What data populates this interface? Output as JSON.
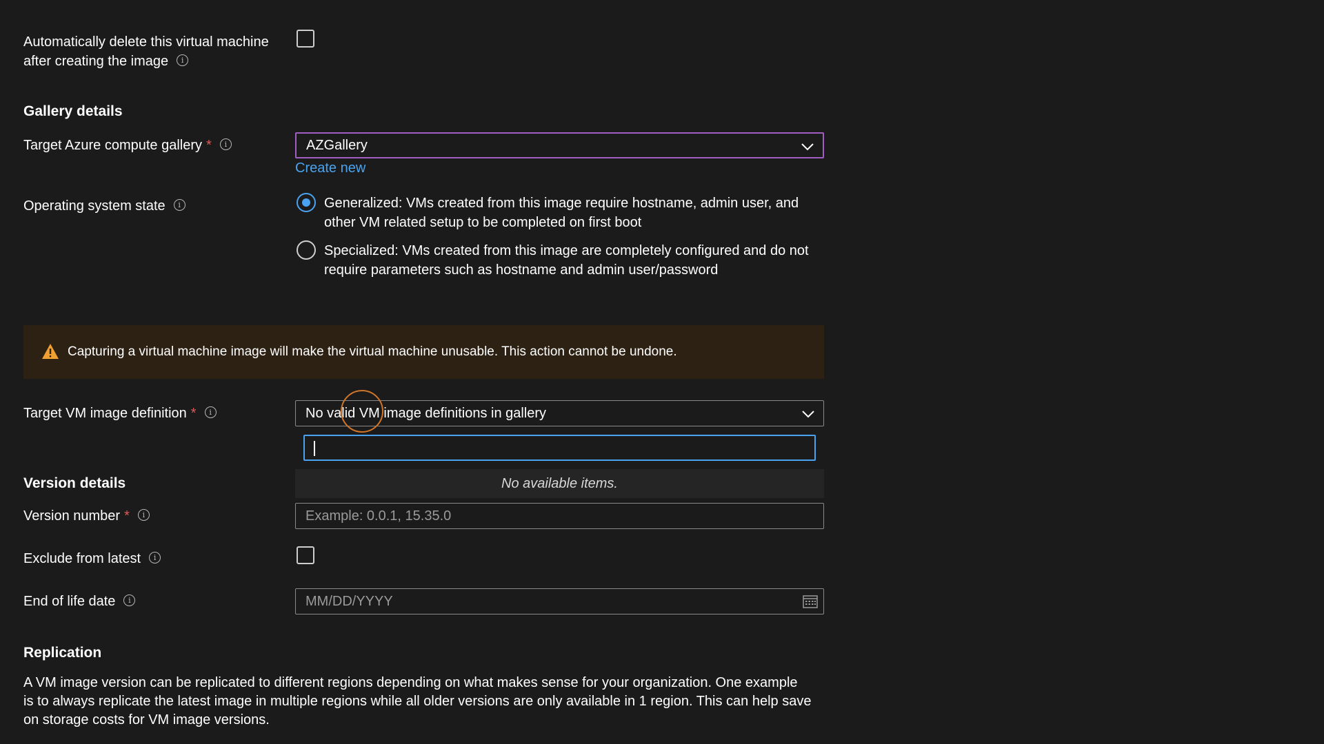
{
  "auto_delete": {
    "label_line1": "Automatically delete this virtual machine",
    "label_line2": "after creating the image",
    "checked": false
  },
  "gallery_details": {
    "heading": "Gallery details",
    "target_gallery_label": "Target Azure compute gallery",
    "target_gallery_value": "AZGallery",
    "create_new_link": "Create new",
    "os_state_label": "Operating system state",
    "os_state_options": [
      {
        "line1": "Generalized: VMs created from this image require hostname, admin user, and",
        "line2": "other VM related setup to be completed on first boot",
        "selected": true
      },
      {
        "line1": "Specialized: VMs created from this image are completely configured and do not",
        "line2": "require parameters such as hostname and admin user/password",
        "selected": false
      }
    ]
  },
  "warning": {
    "text": "Capturing a virtual machine image will make the virtual machine unusable. This action cannot be undone.",
    "icon": "warning-icon"
  },
  "image_definition": {
    "label": "Target VM image definition",
    "value": "No valid VM image definitions in gallery",
    "search_value": "",
    "empty_text": "No available items."
  },
  "version_details": {
    "heading": "Version details",
    "version_number_label": "Version number",
    "version_number_placeholder": "Example: 0.0.1, 15.35.0",
    "exclude_latest_label": "Exclude from latest",
    "exclude_latest_checked": false,
    "eol_label": "End of life date",
    "eol_placeholder": "MM/DD/YYYY"
  },
  "replication": {
    "heading": "Replication",
    "line1": "A VM image version can be replicated to different regions depending on what makes sense for your organization. One example",
    "line2": "is to always replicate the latest image in multiple regions while all older versions are only available in 1 region. This can help save",
    "line3": "on storage costs for VM image versions."
  },
  "required_marker": "*",
  "info_glyph": "i",
  "colors": {
    "background": "#1b1b1b",
    "accent": "#4aa3f0",
    "required": "#e05a5a",
    "gallery_border": "#a25ec4",
    "warning_bg": "#2d2114",
    "warning_icon": "#f0a030"
  }
}
